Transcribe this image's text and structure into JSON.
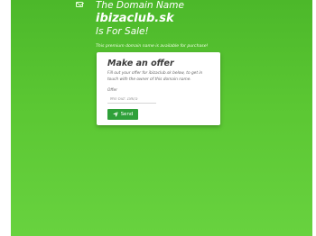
{
  "hero": {
    "line1": "The Domain Name",
    "domain": "ibizaclub.sk",
    "line2": "Is For Sale!",
    "note": "This premium domain name is available for purchase!"
  },
  "card": {
    "title": "Make an offer",
    "description": "Fill out your offer for ibizaclub.sk below, to get in touch with the owner of this domain name.",
    "offer_label": "Offer",
    "offer_placeholder": "Min bid: 18k/a",
    "offer_value": "",
    "send_label": "Send"
  },
  "icons": {
    "mail": "envelope-icon",
    "send": "paper-plane-icon"
  },
  "colors": {
    "background_green": "#5bc733",
    "button_green": "#2fa03a",
    "card_background": "#ffffff"
  }
}
